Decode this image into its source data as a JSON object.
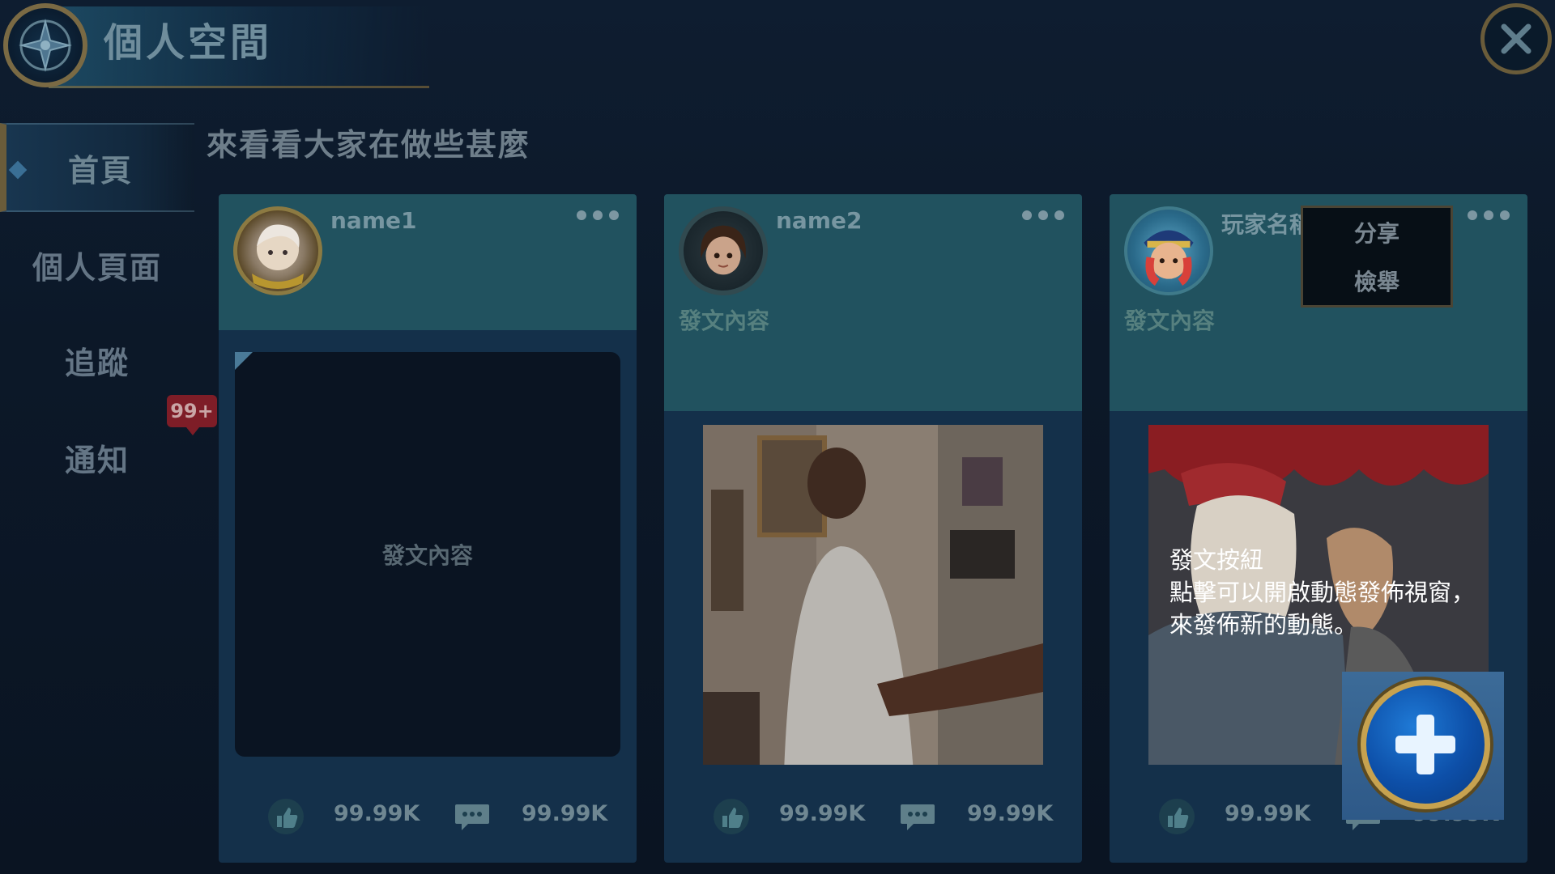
{
  "header": {
    "title": "個人空間"
  },
  "sidebar": {
    "items": [
      {
        "label": "首頁"
      },
      {
        "label": "個人頁面"
      },
      {
        "label": "追蹤"
      },
      {
        "label": "通知"
      }
    ],
    "notification_badge": "99+"
  },
  "feed": {
    "heading": "來看看大家在做些甚麼",
    "posts": [
      {
        "author": "name1",
        "content": "發文內容",
        "likes": "99.99K",
        "comments": "99.99K"
      },
      {
        "author": "name2",
        "content": "發文內容",
        "likes": "99.99K",
        "comments": "99.99K"
      },
      {
        "author": "玩家名稱",
        "content": "發文內容",
        "likes": "99.99K",
        "comments": "99.99K"
      }
    ]
  },
  "post_menu": {
    "items": [
      "分享",
      "檢舉"
    ]
  },
  "tooltip": {
    "line1": "發文按紐",
    "line2": "點擊可以開啟動態發佈視窗，",
    "line3": "來發佈新的動態。"
  },
  "colors": {
    "accent_gold": "#c7a24f",
    "fab_blue": "#0d4fa8",
    "card_teal": "#21525f",
    "badge_red": "#7e1d27"
  }
}
